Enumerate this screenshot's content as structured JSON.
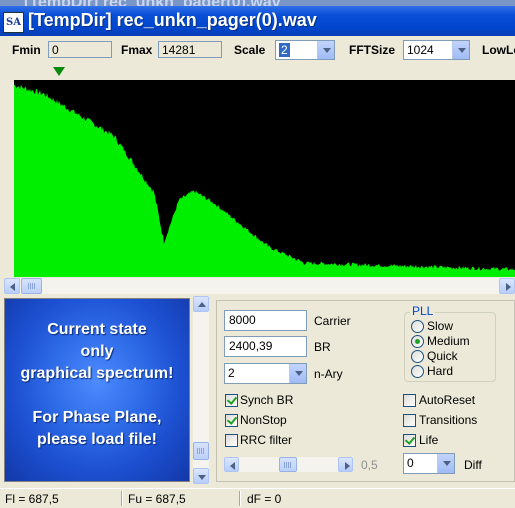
{
  "background_title": "[TempDir] rec_unkn_pager(0).wav",
  "window": {
    "app_icon_text": "SA",
    "title": "[TempDir] rec_unkn_pager(0).wav"
  },
  "toolbar": {
    "fmin_label": "Fmin",
    "fmin_value": "0",
    "fmax_label": "Fmax",
    "fmax_value": "14281",
    "scale_label": "Scale",
    "scale_value": "2",
    "fftsize_label": "FFTSize",
    "fftsize_value": "1024",
    "lowlevel_label": "LowLe"
  },
  "spectrum": {
    "background": "#000000",
    "trace_color": "#00ee00",
    "marker_color": "#0a8a0a"
  },
  "state_panel": {
    "lines": [
      "Current state",
      "only",
      "graphical spectrum!",
      "",
      "For Phase Plane,",
      "please load file!"
    ]
  },
  "controls": {
    "carrier_value": "8000",
    "carrier_label": "Carrier",
    "br_value": "2400,39",
    "br_label": "BR",
    "nary_value": "2",
    "nary_label": "n-Ary",
    "synch_br_label": "Synch BR",
    "synch_br_checked": true,
    "nonstop_label": "NonStop",
    "nonstop_checked": true,
    "rrc_filter_label": "RRC filter",
    "rrc_filter_checked": false,
    "slider_value": "0,5",
    "autoreset_label": "AutoReset",
    "autoreset_checked": false,
    "transitions_label": "Transitions",
    "transitions_checked": false,
    "life_label": "Life",
    "life_checked": true,
    "diff_value": "0",
    "diff_label": "Diff"
  },
  "pll": {
    "title": "PLL",
    "options": [
      "Slow",
      "Medium",
      "Quick",
      "Hard"
    ],
    "selected": "Medium"
  },
  "statusbar": {
    "fl": "Fl = 687,5",
    "fu": "Fu = 687,5",
    "df": "dF = 0"
  }
}
